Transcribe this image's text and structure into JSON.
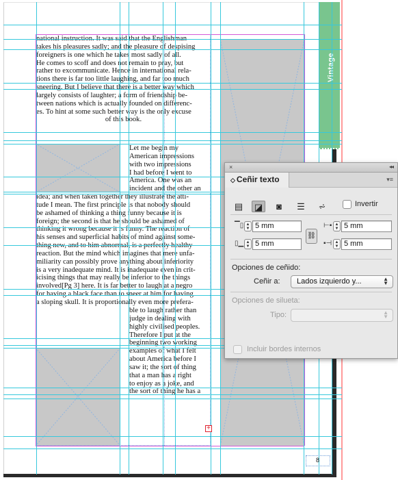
{
  "document": {
    "tab_label": "Vintage",
    "page_number": "8",
    "overflow_marker": "+",
    "text_block_1": [
      "national instruction. It was said that the Englishman",
      "takes his pleasures sadly; and the pleasure of despising",
      "foreigners is one which he takes most sadly of all.",
      "He comes to scoff and does not remain to pray, but",
      "rather to excommunicate. Hence in international rela-",
      "tions there is far too little laughing, and far too much",
      "sneering. But I believe that there is a better way which",
      "largely consists of laughter; a form of friendship be-",
      "tween nations which is actually founded on differenc-",
      "es. To hint at some such better way is the only excuse"
    ],
    "text_block_1_last": "of this book.",
    "text_block_2": [
      "Let me begin my",
      "American impressions",
      "with two impressions",
      "I had before I went to",
      "America. One was an",
      "incident and the other an"
    ],
    "text_block_3": [
      "idea; and when taken together they illustrate the atti-",
      "tude I mean. The first principle is that nobody should",
      "be ashamed of thinking a thing funny because it is",
      "foreign; the second is that he should be ashamed of",
      "thinking it wrong because it is funny. The reaction of",
      "his senses and superficial habits of mind against some-",
      "thing new, and to him abnormal, is a perfectly healthy",
      "reaction. But the mind which imagines that mere unfa-",
      "miliarity can possibly prove anything about inferiority",
      "is a very inadequate mind. It is inadequate even in crit-",
      "icising things that may really be inferior to the things",
      "involved[Pg 3] here. It is far better to laugh at a negro",
      "for having a black face than to sneer at him for having",
      "a sloping skull. It is proportionally even more prefera-"
    ],
    "text_block_4": [
      "ble to laugh rather than",
      "judge in dealing with",
      "highly civilised peoples.",
      "Therefore I put at the",
      "beginning two working",
      "examples of what I felt",
      "about America before I",
      "saw it; the sort of thing",
      "that a man has a right",
      "to enjoy as a joke, and",
      "the sort of thing he has a"
    ]
  },
  "panel": {
    "close_icon": "×",
    "collapse_icon": "◂◂",
    "title": "Ceñir texto",
    "title_icon": "◇",
    "menu_icon": "▾≡",
    "wrap_buttons": [
      {
        "name": "no-wrap",
        "glyph": "▤",
        "selected": false
      },
      {
        "name": "wrap-bounding-box",
        "glyph": "◪",
        "selected": true
      },
      {
        "name": "wrap-object-shape",
        "glyph": "◙",
        "selected": false
      },
      {
        "name": "jump-object",
        "glyph": "☰",
        "selected": false
      },
      {
        "name": "jump-next-column",
        "glyph": "⩫",
        "selected": false
      }
    ],
    "invert_label": "Invertir",
    "offsets": {
      "top": "5 mm",
      "bottom": "5 mm",
      "left": "5 mm",
      "right": "5 mm"
    },
    "link_icon": "⛓",
    "wrap_options_heading": "Opciones de ceñido:",
    "wrap_to_label": "Ceñir a:",
    "wrap_to_value": "Lados izquierdo y...",
    "contour_heading": "Opciones de silueta:",
    "type_label": "Tipo:",
    "type_value": "",
    "include_inside_edges": "Incluir bordes internos"
  }
}
